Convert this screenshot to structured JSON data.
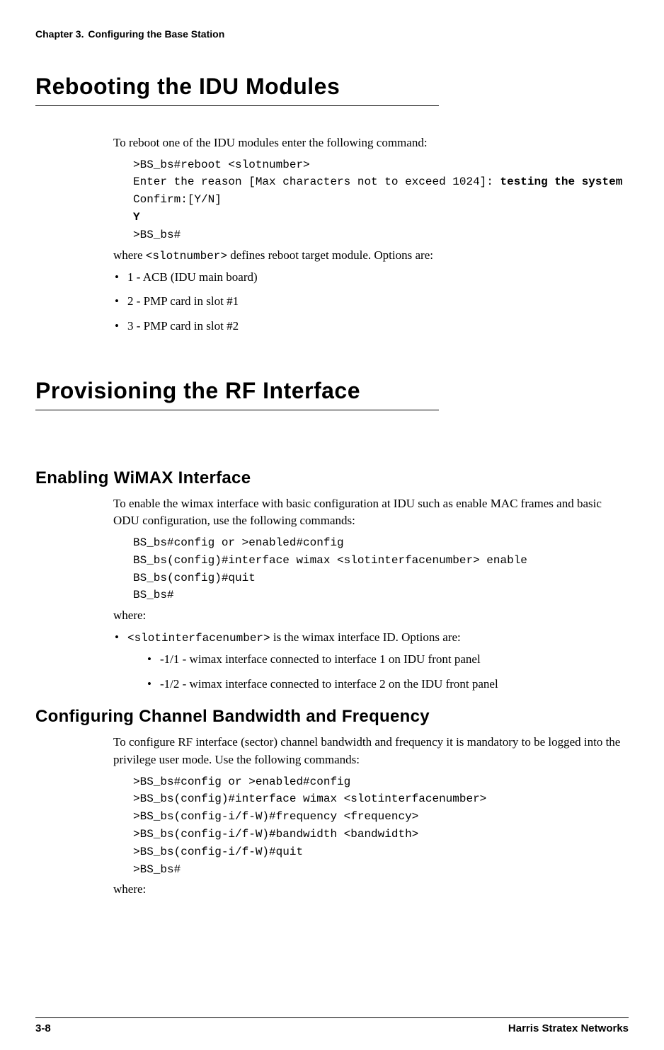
{
  "header": {
    "chapter_label": "Chapter 3.",
    "chapter_title": "Configuring the Base Station"
  },
  "section1": {
    "title": "Rebooting the IDU Modules",
    "intro": "To reboot one of the IDU modules enter the following command:",
    "code_line1": ">BS_bs#reboot <slotnumber>",
    "code_line2a": "Enter the reason [Max characters not to exceed 1024]: ",
    "code_line2b": "testing the system",
    "code_line3": "Confirm:[Y/N]",
    "code_line4": "Y",
    "code_line5": ">BS_bs#",
    "where_a": "where ",
    "where_code": "<slotnumber>",
    "where_b": " defines reboot target module. Options are:",
    "bullets": [
      "1 - ACB (IDU main board)",
      "2 - PMP card in slot #1",
      "3 - PMP card in slot #2"
    ]
  },
  "section2": {
    "title": "Provisioning the RF Interface",
    "sub1": {
      "title": "Enabling WiMAX Interface",
      "intro": "To enable the wimax interface with basic configuration at IDU such as enable MAC frames and basic ODU configuration, use the following commands:",
      "code_line1": "BS_bs#config or >enabled#config",
      "code_line2": "BS_bs(config)#interface wimax <slotinterfacenumber> enable",
      "code_line3": "BS_bs(config)#quit",
      "code_line4": "BS_bs#",
      "where": "where:",
      "bullet_code": "<slotinterfacenumber>",
      "bullet_rest": " is the wimax interface ID. Options are:",
      "inner_bullets": [
        "-1/1 - wimax interface connected to interface 1 on IDU front panel",
        "-1/2 - wimax interface connected to interface 2 on the IDU front panel"
      ]
    },
    "sub2": {
      "title": "Configuring Channel Bandwidth and Frequency",
      "intro": "To configure RF interface (sector) channel bandwidth and frequency it is mandatory to be logged into the privilege user mode. Use the following commands:",
      "code_line1": ">BS_bs#config or >enabled#config",
      "code_line2": ">BS_bs(config)#interface wimax <slotinterfacenumber>",
      "code_line3": ">BS_bs(config-i/f-W)#frequency <frequency>",
      "code_line4": ">BS_bs(config-i/f-W)#bandwidth <bandwidth>",
      "code_line5": ">BS_bs(config-i/f-W)#quit",
      "code_line6": ">BS_bs#",
      "where": "where:"
    }
  },
  "footer": {
    "page": "3-8",
    "company": "Harris Stratex Networks"
  }
}
